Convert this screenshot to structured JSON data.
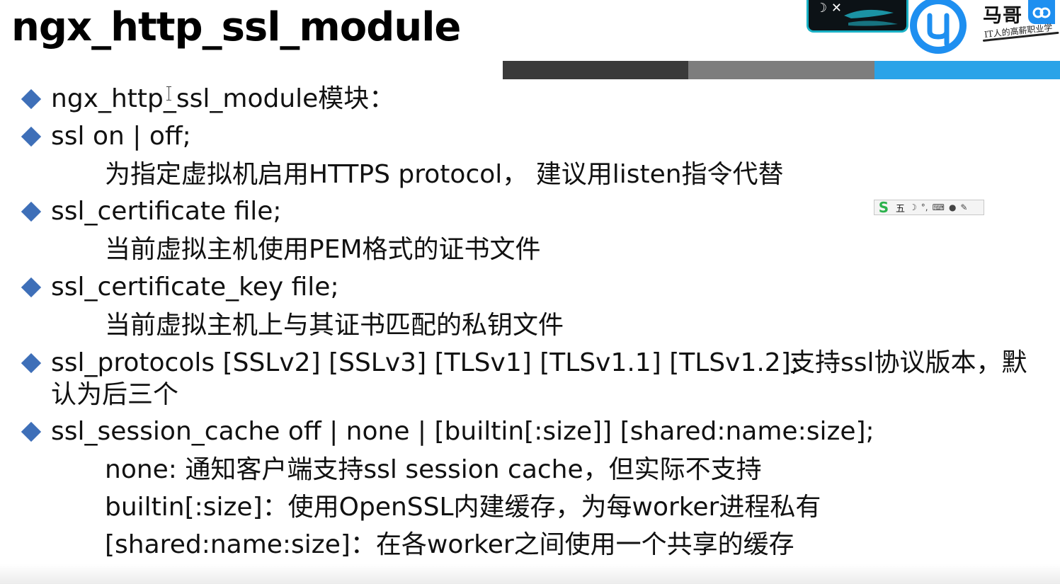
{
  "slide": {
    "title": "ngx_http_ssl_module"
  },
  "header": {
    "accent_colors": [
      "#3a3a3a",
      "#7d7d7d",
      "#2aa3e8"
    ],
    "brand_name": "马哥",
    "brand_tagline": "IT人的高薪职业学",
    "video_glyph": "☽ ✕"
  },
  "ime_toolbar": {
    "mode_label": "五",
    "icons": [
      "moon-icon",
      "punctuation-icon",
      "keyboard-icon",
      "user-icon",
      "wrench-icon"
    ]
  },
  "items": [
    {
      "text": "ngx_http_ssl_module模块："
    },
    {
      "text": "ssl on | off;"
    },
    {
      "sub": "为指定虚拟机启用HTTPS protocol， 建议用listen指令代替"
    },
    {
      "text": "ssl_certificate file;"
    },
    {
      "sub": "当前虚拟主机使用PEM格式的证书文件"
    },
    {
      "text": "ssl_certificate_key file;"
    },
    {
      "sub": "当前虚拟主机上与其证书匹配的私钥文件"
    },
    {
      "text": "ssl_protocols [SSLv2] [SSLv3] [TLSv1] [TLSv1.1] [TLSv1.2];",
      "text_right": "支持ssl协议版本，默",
      "text_cont": "认为后三个"
    },
    {
      "text": "ssl_session_cache off | none | [builtin[:size]] [shared:name:size];"
    },
    {
      "sub": "none:  通知客户端支持ssl session cache，但实际不支持"
    },
    {
      "sub": "builtin[:size]：使用OpenSSL内建缓存，为每worker进程私有"
    },
    {
      "sub": "[shared:name:size]：在各worker之间使用一个共享的缓存"
    }
  ]
}
